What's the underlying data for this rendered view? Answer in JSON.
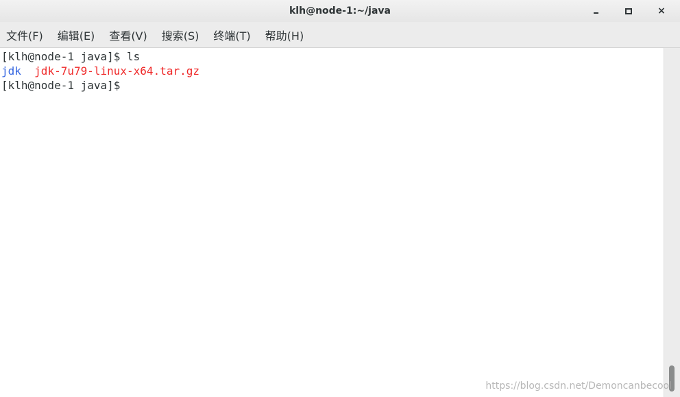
{
  "window": {
    "title": "klh@node-1:~/java",
    "controls": {
      "minimize_icon": "minimize-icon",
      "maximize_icon": "maximize-icon",
      "close_icon": "close-icon",
      "close_glyph": "×"
    }
  },
  "menubar": {
    "items": [
      {
        "label": "文件(F)"
      },
      {
        "label": "编辑(E)"
      },
      {
        "label": "查看(V)"
      },
      {
        "label": "搜索(S)"
      },
      {
        "label": "终端(T)"
      },
      {
        "label": "帮助(H)"
      }
    ]
  },
  "terminal": {
    "lines": [
      {
        "prompt": "[klh@node-1 java]$ ",
        "command": "ls"
      },
      {
        "dir": "jdk",
        "separator": "  ",
        "archive": "jdk-7u79-linux-x64.tar.gz"
      },
      {
        "prompt": "[klh@node-1 java]$ ",
        "command": ""
      }
    ],
    "colors": {
      "text": "#2e3436",
      "directory": "#3465e0",
      "archive": "#ef2929",
      "background": "#ffffff"
    }
  },
  "watermark": {
    "text": "https://blog.csdn.net/Demoncanbecool"
  }
}
